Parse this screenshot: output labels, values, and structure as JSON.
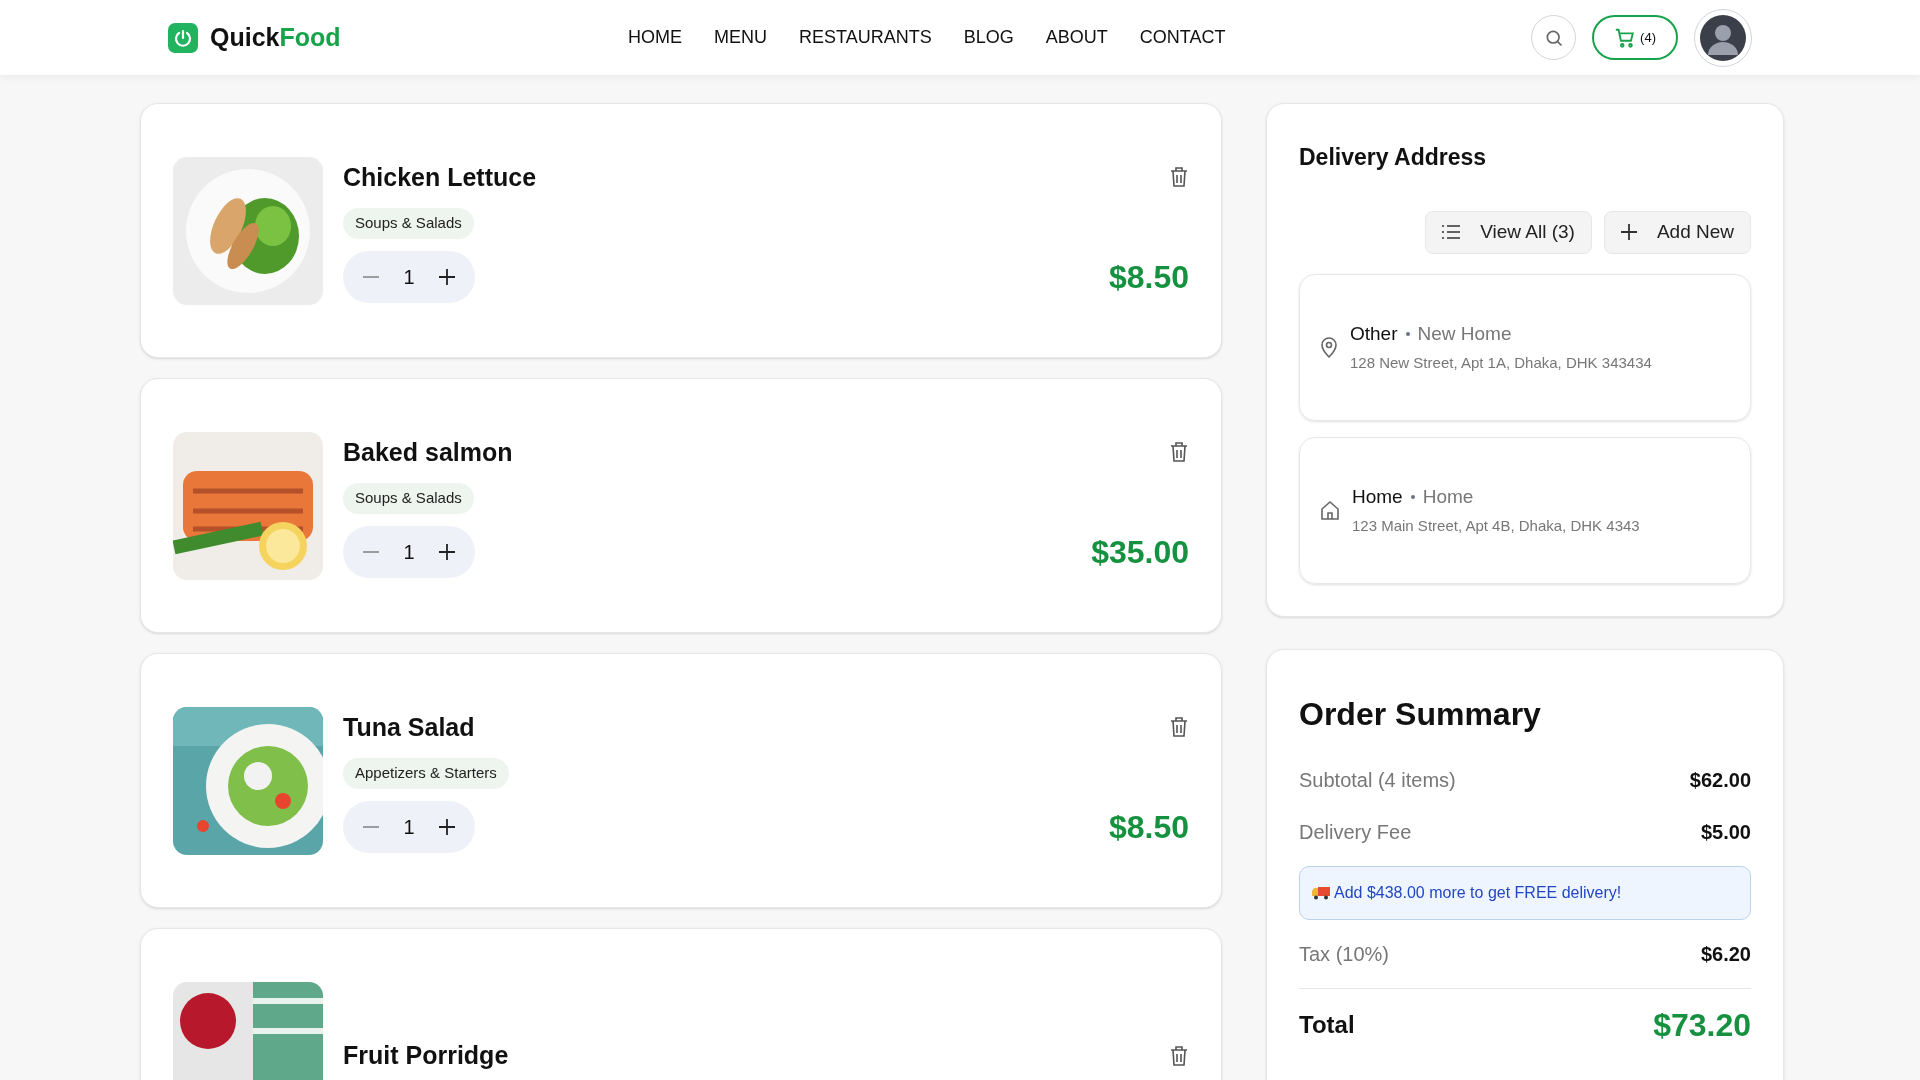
{
  "brand": {
    "first": "Quick",
    "second": "Food"
  },
  "nav": [
    {
      "label": "HOME"
    },
    {
      "label": "MENU"
    },
    {
      "label": "RESTAURANTS"
    },
    {
      "label": "BLOG"
    },
    {
      "label": "ABOUT"
    },
    {
      "label": "CONTACT"
    }
  ],
  "cart_count": "(4)",
  "cart_items": [
    {
      "name": "Chicken Lettuce",
      "category": "Soups & Salads",
      "quantity": "1",
      "price": "$8.50"
    },
    {
      "name": "Baked salmon",
      "category": "Soups & Salads",
      "quantity": "1",
      "price": "$35.00"
    },
    {
      "name": "Tuna Salad",
      "category": "Appetizers & Starters",
      "quantity": "1",
      "price": "$8.50"
    },
    {
      "name": "Fruit Porridge"
    }
  ],
  "delivery": {
    "title": "Delivery Address",
    "buttons": [
      {
        "kind": "list",
        "label": "View All (3)"
      },
      {
        "kind": "add",
        "label": "Add New"
      }
    ],
    "addresses": [
      {
        "kind": "pin",
        "label": "Other",
        "name": "New Home",
        "address": "128 New Street, Apt 1A, Dhaka, DHK 343434"
      },
      {
        "kind": "home",
        "label": "Home",
        "name": "Home",
        "address": "123 Main Street, Apt 4B, Dhaka, DHK 4343"
      }
    ]
  },
  "summary": {
    "title": "Order Summary",
    "rows": [
      {
        "kind": "line",
        "label": "Subtotal (4 items)",
        "value": "$62.00"
      },
      {
        "kind": "line",
        "label": "Delivery Fee",
        "value": "$5.00"
      },
      {
        "kind": "notice",
        "label": "Add $438.00 more to get FREE delivery!"
      },
      {
        "kind": "line",
        "label": "Tax (10%)",
        "value": "$6.20"
      },
      {
        "kind": "total",
        "label": "Total",
        "value": "$73.20"
      }
    ]
  }
}
